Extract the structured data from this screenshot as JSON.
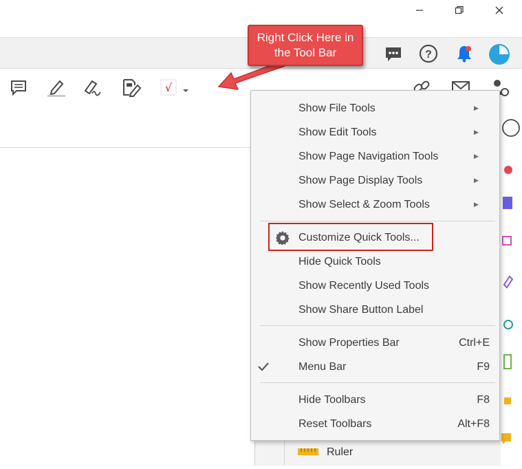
{
  "window": {
    "minimize_icon": "minimize-icon",
    "restore_icon": "restore-icon",
    "close_icon": "close-icon"
  },
  "topbar": {
    "icons": [
      "chat-icon",
      "help-icon",
      "notification-bell-icon",
      "profile-avatar-icon"
    ],
    "accent_color": "#1473e6"
  },
  "toolbar": {
    "icons": [
      "comment-icon",
      "highlight-icon",
      "fill-sign-icon",
      "edit-pdf-icon",
      "stamp-icon",
      "chevron-down-icon",
      "link-icon",
      "email-icon",
      "share-user-icon"
    ]
  },
  "callout": {
    "text": "Right Click Here in the Tool Bar",
    "color": "#e84c4c"
  },
  "context_menu": {
    "items": [
      {
        "label": "Show File Tools",
        "submenu": true
      },
      {
        "label": "Show Edit Tools",
        "submenu": true
      },
      {
        "label": "Show Page Navigation Tools",
        "submenu": true
      },
      {
        "label": "Show Page Display Tools",
        "submenu": true
      },
      {
        "label": "Show Select & Zoom Tools",
        "submenu": true
      },
      {
        "label": "Customize Quick Tools...",
        "icon": "gear-icon",
        "highlighted": true
      },
      {
        "label": "Hide Quick Tools"
      },
      {
        "label": "Show Recently Used Tools"
      },
      {
        "label": "Show Share Button Label"
      },
      {
        "label": "Show Properties Bar",
        "shortcut": "Ctrl+E"
      },
      {
        "label": "Menu Bar",
        "shortcut": "F9",
        "checked": true
      },
      {
        "label": "Hide Toolbars",
        "shortcut": "F8"
      },
      {
        "label": "Reset Toolbars",
        "shortcut": "Alt+F8"
      }
    ],
    "highlight_color": "#d02020"
  },
  "lower_panel": {
    "ruler_label": "Ruler"
  }
}
